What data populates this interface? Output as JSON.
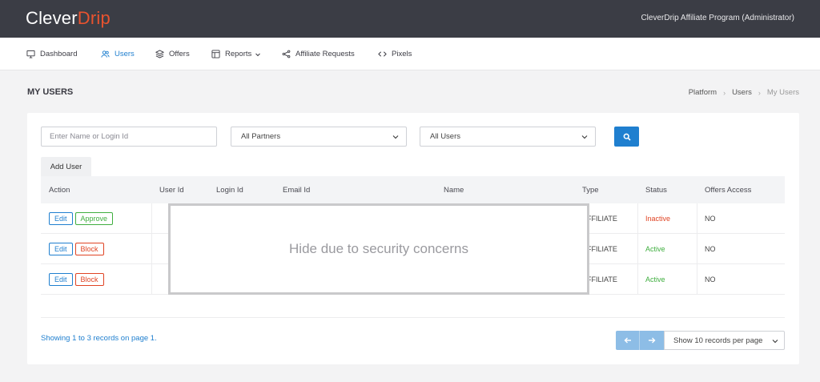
{
  "header": {
    "logo_main": "Clever",
    "logo_accent": "Drip",
    "title": "CleverDrip Affiliate Program (Administrator)"
  },
  "nav": {
    "items": [
      {
        "label": "Dashboard",
        "icon": "monitor-icon"
      },
      {
        "label": "Users",
        "icon": "users-icon",
        "active": true
      },
      {
        "label": "Offers",
        "icon": "layers-icon"
      },
      {
        "label": "Reports",
        "icon": "layout-icon",
        "has_dropdown": true
      },
      {
        "label": "Affiliate Requests",
        "icon": "share-icon"
      },
      {
        "label": "Pixels",
        "icon": "code-icon"
      }
    ]
  },
  "page": {
    "title": "MY USERS",
    "breadcrumb": [
      "Platform",
      "Users",
      "My Users"
    ]
  },
  "filters": {
    "search_placeholder": "Enter Name or Login Id",
    "partners_selected": "All Partners",
    "users_selected": "All Users",
    "search_icon": "search-icon"
  },
  "tabs": {
    "add_user": "Add User"
  },
  "table": {
    "columns": [
      "Action",
      "User Id",
      "Login Id",
      "Email Id",
      "Name",
      "Type",
      "Status",
      "Offers Access"
    ],
    "rows": [
      {
        "actions": [
          "Edit",
          "Approve"
        ],
        "type": "AFFILIATE",
        "status": "Inactive",
        "offers_access": "NO"
      },
      {
        "actions": [
          "Edit",
          "Block"
        ],
        "type": "AFFILIATE",
        "status": "Active",
        "offers_access": "NO"
      },
      {
        "actions": [
          "Edit",
          "Block"
        ],
        "type": "AFFILIATE",
        "status": "Active",
        "offers_access": "NO"
      }
    ],
    "mask_text": "Hide due to security concerns"
  },
  "footer": {
    "showing": "Showing 1 to 3 records on page 1.",
    "per_page": "Show 10 records per page"
  },
  "colors": {
    "accent": "#1f7fcf",
    "topbar": "#3b3d45",
    "brand": "#e8532f",
    "active": "#3fae3f",
    "inactive": "#e04424"
  }
}
